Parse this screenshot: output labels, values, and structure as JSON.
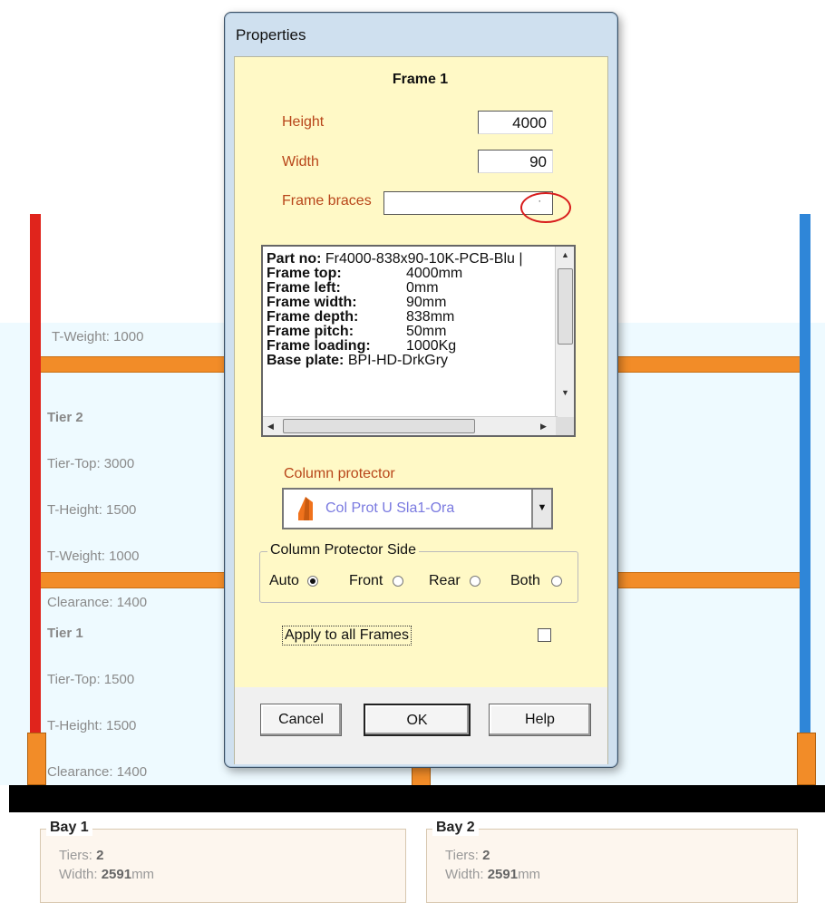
{
  "dialog": {
    "title": "Properties",
    "frame_title": "Frame 1",
    "height_label": "Height",
    "height_value": "4000",
    "width_label": "Width",
    "width_value": "90",
    "frame_braces_label": "Frame braces",
    "frame_braces_value": "",
    "details": [
      {
        "key": "Part no:",
        "val": "Fr4000-838x90-10K-PCB-Blu |"
      },
      {
        "key": "Frame top:",
        "val": "4000mm"
      },
      {
        "key": "Frame left:",
        "val": "0mm"
      },
      {
        "key": "Frame width:",
        "val": "90mm"
      },
      {
        "key": "Frame depth:",
        "val": "838mm"
      },
      {
        "key": "Frame pitch:",
        "val": "50mm"
      },
      {
        "key": "Frame loading:",
        "val": "1000Kg"
      },
      {
        "key": "Base plate:",
        "val": "BPI-HD-DrkGry"
      }
    ],
    "column_protector_label": "Column protector",
    "column_protector_value": "Col Prot U Sla1-Ora",
    "protector_side_legend": "Column Protector Side",
    "sides": [
      {
        "label": "Auto",
        "selected": true
      },
      {
        "label": "Front",
        "selected": false
      },
      {
        "label": "Rear",
        "selected": false
      },
      {
        "label": "Both",
        "selected": false
      }
    ],
    "apply_label": "Apply to all Frames",
    "apply_checked": false,
    "buttons": {
      "cancel": "Cancel",
      "ok": "OK",
      "help": "Help"
    }
  },
  "rack": {
    "top_weight": "T-Weight: 1000",
    "tier2": {
      "name": "Tier 2",
      "top": "Tier-Top: 3000",
      "height": "T-Height: 1500",
      "weight": "T-Weight: 1000",
      "clearance": "Clearance: 1400"
    },
    "tier1": {
      "name": "Tier 1",
      "top": "Tier-Top: 1500",
      "height": "T-Height: 1500",
      "clearance": "Clearance: 1400"
    },
    "colors": {
      "left_upright": "#e0241c",
      "right_upright": "#2f86d8",
      "beam": "#f28c28"
    }
  },
  "bays": [
    {
      "name": "Bay 1",
      "tiers_label": "Tiers:",
      "tiers_value": "2",
      "width_label": "Width:",
      "width_value": "2591",
      "width_unit": "mm"
    },
    {
      "name": "Bay 2",
      "tiers_label": "Tiers:",
      "tiers_value": "2",
      "width_label": "Width:",
      "width_value": "2591",
      "width_unit": "mm"
    }
  ]
}
